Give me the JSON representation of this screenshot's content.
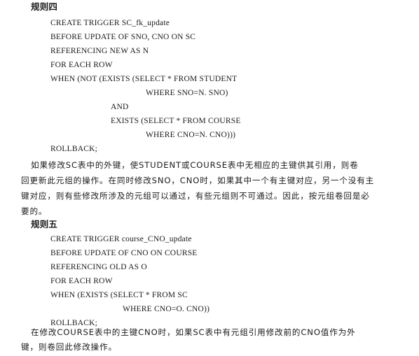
{
  "rule4": {
    "heading": "规则四",
    "code": [
      "CREATE TRIGGER SC_fk_update",
      "BEFORE UPDATE OF SNO, CNO ON SC",
      "REFERENCING NEW AS N",
      "FOR EACH ROW",
      "WHEN (NOT (EXISTS (SELECT * FROM STUDENT",
      "WHERE SNO=N. SNO)",
      "AND",
      "EXISTS (SELECT * FROM COURSE",
      "WHERE CNO=N. CNO)))",
      "ROLLBACK;"
    ],
    "paragraph": [
      "如果修改SC表中的外键，使STUDENT或COURSE表中无相应的主键供其引用，则卷",
      "回更新此元组的操作。在同时修改SNO，CNO时，如果其中一个有主键对应，另一个没有主",
      "键对应，则有些修改所涉及的元组可以通过，有些元组则不可通过。因此，按元组卷回是必",
      "要的。"
    ]
  },
  "rule5": {
    "heading": "规则五",
    "code": [
      "CREATE TRIGGER course_CNO_update",
      "BEFORE UPDATE OF CNO ON COURSE",
      "REFERENCING OLD AS O",
      "FOR EACH ROW",
      "WHEN (EXISTS (SELECT * FROM SC",
      "WHERE CNO=O. CNO))",
      "ROLLBACK;"
    ],
    "paragraph": [
      "在修改COURSE表中的主键CNO时，如果SC表中有元组引用修改前的CNO值作为外",
      "键，则卷回此修改操作。"
    ]
  }
}
